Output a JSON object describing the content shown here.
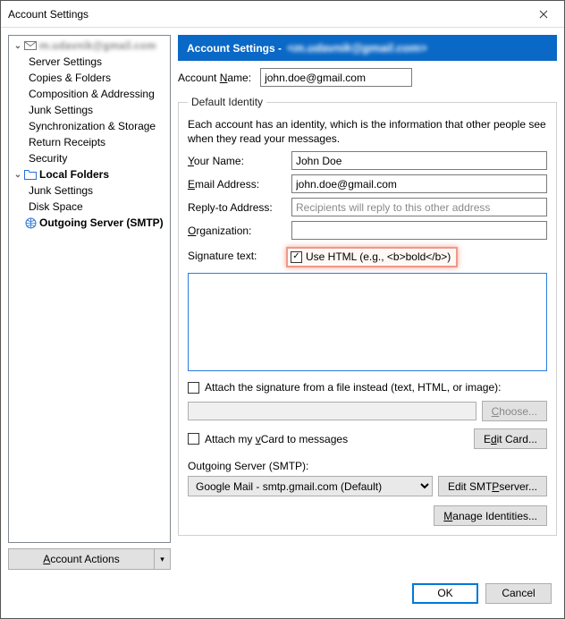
{
  "window": {
    "title": "Account Settings"
  },
  "sidebar": {
    "account_email_masked": "m.udavnik@gmail.com",
    "items": [
      "Server Settings",
      "Copies & Folders",
      "Composition & Addressing",
      "Junk Settings",
      "Synchronization & Storage",
      "Return Receipts",
      "Security"
    ],
    "local_folders_label": "Local Folders",
    "local_items": [
      "Junk Settings",
      "Disk Space"
    ],
    "outgoing_label": "Outgoing Server (SMTP)",
    "account_actions_label": "Account Actions"
  },
  "header": {
    "title": "Account Settings -",
    "account_masked": "<m.udavnik@gmail.com>"
  },
  "account_name": {
    "label": "Account Name:",
    "value": "john.doe@gmail.com"
  },
  "identity": {
    "legend": "Default Identity",
    "description": "Each account has an identity, which is the information that other people see when they read your messages.",
    "your_name": {
      "label": "Your Name:",
      "value": "John Doe"
    },
    "email": {
      "label": "Email Address:",
      "value": "john.doe@gmail.com"
    },
    "reply_to": {
      "label": "Reply-to Address:",
      "placeholder": "Recipients will reply to this other address",
      "value": ""
    },
    "organization": {
      "label": "Organization:",
      "value": ""
    },
    "signature_label": "Signature text:",
    "use_html": {
      "checked": true,
      "label": "Use HTML (e.g., <b>bold</b>)"
    },
    "signature_text": "",
    "attach_file": {
      "checked": false,
      "label": "Attach the signature from a file instead (text, HTML, or image):"
    },
    "choose_btn": "Choose...",
    "attach_vcard": {
      "checked": false,
      "label": "Attach my vCard to messages"
    },
    "edit_card_btn": "Edit Card...",
    "smtp_label": "Outgoing Server (SMTP):",
    "smtp_selected": "Google Mail - smtp.gmail.com (Default)",
    "edit_smtp_btn": "Edit SMTP server...",
    "manage_identities_btn": "Manage Identities..."
  },
  "footer": {
    "ok": "OK",
    "cancel": "Cancel"
  }
}
